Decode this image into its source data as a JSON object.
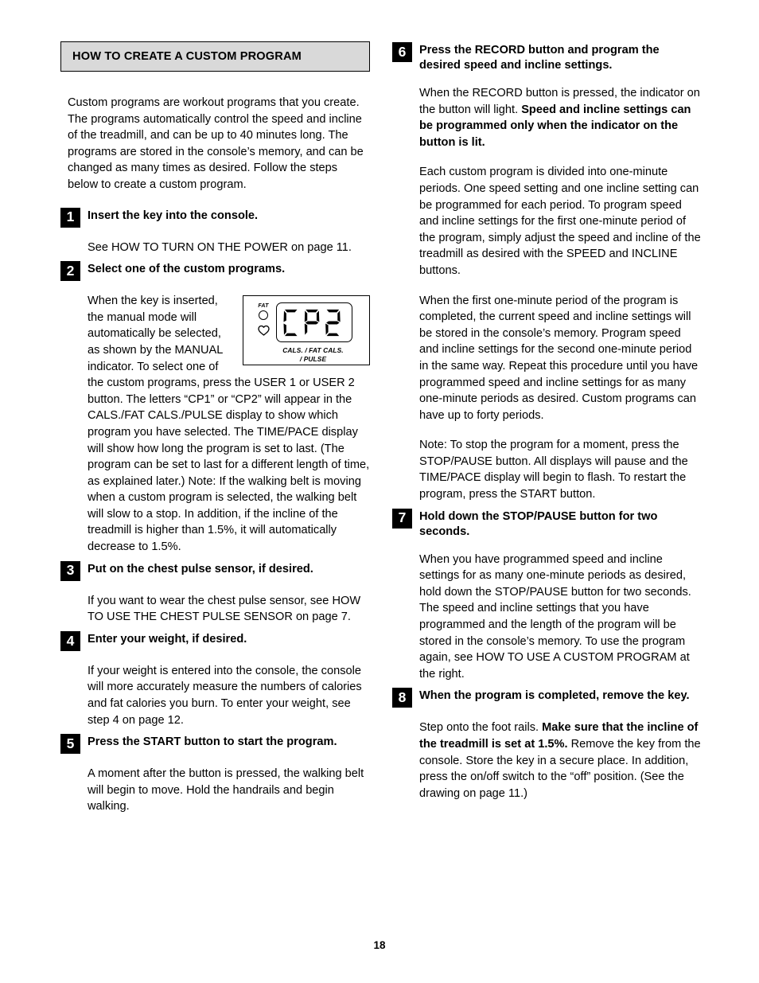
{
  "document": {
    "page_number": "18",
    "section_header": "HOW TO CREATE A CUSTOM PROGRAM",
    "intro": "Custom programs are workout programs that you create. The programs automatically control the speed and incline of the treadmill, and can be up to 40 minutes long. The programs are stored in the console’s memory, and can be changed as many times as desired. Follow the steps below to create a custom program."
  },
  "colors": {
    "header_fill": "#d9d9d9",
    "header_border": "#000000",
    "step_badge": "#000000",
    "step_badge_text": "#ffffff",
    "text": "#000000",
    "page_background": "#ffffff"
  },
  "illustration": {
    "fat_label": "FAT",
    "lcd_value": "CP2",
    "caption_line1": "CALS. / FAT CALS.",
    "caption_line2": "/ PULSE",
    "indicator_icons": [
      "circle-indicator",
      "heart-indicator"
    ]
  },
  "steps": {
    "left": [
      {
        "number": "1",
        "title": "Insert the key into the console.",
        "paragraphs": [
          "See HOW TO TURN ON THE POWER on page 11."
        ]
      },
      {
        "number": "2",
        "title": "Select one of the custom programs.",
        "paragraphs": [
          "When the key is inserted, the manual mode will automatically be selected, as shown by the MANUAL indicator. To select one of the custom programs, press the USER 1 or USER 2 button. The letters “CP1” or “CP2” will appear in the CALS./FAT CALS./PULSE display to show which program you have selected. The TIME/PACE display will show how long the program is set to last. (The program can be set to last for a different length of time, as explained later.) Note: If the walking belt is moving when a custom program is selected, the walking belt will slow to a stop. In addition, if the incline of the treadmill is higher than 1.5%, it will automatically decrease to 1.5%."
        ]
      },
      {
        "number": "3",
        "title": "Put on the chest pulse sensor, if desired.",
        "paragraphs": [
          "If you want to wear the chest pulse sensor, see HOW TO USE THE CHEST PULSE SENSOR on page 7."
        ]
      },
      {
        "number": "4",
        "title": "Enter your weight, if desired.",
        "paragraphs": [
          "If your weight is entered into the console, the console will more accurately measure the numbers of calories and fat calories you burn. To enter your weight, see step 4 on page 12."
        ]
      },
      {
        "number": "5",
        "title": "Press the START button to start the program.",
        "paragraphs": [
          "A moment after the button is pressed, the walking belt will begin to move. Hold the handrails and begin walking."
        ]
      }
    ],
    "right": [
      {
        "number": "6",
        "title": "Press the RECORD button and program the desired speed and incline settings.",
        "p1_plain": "When the RECORD button is pressed, the indicator on the button will light. ",
        "p1_bold": "Speed and incline settings can be programmed only when the indicator on the button is lit.",
        "p2": "Each custom program is divided into one-minute periods. One speed setting and one incline setting can be programmed for each period. To program speed and incline settings for the first one-minute period of the program, simply adjust the speed and incline of the treadmill as desired with the SPEED and INCLINE buttons.",
        "p3": "When the first one-minute period of the program is completed, the current speed and incline settings will be stored in the console’s memory. Program speed and incline settings for the second one-minute period in the same way. Repeat this procedure until you have programmed speed and incline settings for as many one-minute periods as desired. Custom programs can have up to forty periods.",
        "p4": "Note: To stop the program for a moment, press the STOP/PAUSE button. All displays will pause and the TIME/PACE display will begin to flash. To restart the program, press the START button."
      },
      {
        "number": "7",
        "title": "Hold down the STOP/PAUSE button for two seconds.",
        "p1": "When you have programmed speed and incline settings for as many one-minute periods as desired, hold down the STOP/PAUSE button for two seconds. The speed and incline settings that you have programmed and the length of the program will be stored in the console’s memory. To use the program again, see HOW TO USE A CUSTOM PROGRAM at the right."
      },
      {
        "number": "8",
        "title": "When the program is completed, remove the key.",
        "p1_plain_start": "Step onto the foot rails. ",
        "p1_bold": "Make sure that the incline of the treadmill is set at 1.5%.",
        "p1_plain_end": " Remove the key from the console. Store the key in a secure place. In addition, press the on/off switch to the “off” position. (See the drawing on page 11.)"
      }
    ]
  }
}
